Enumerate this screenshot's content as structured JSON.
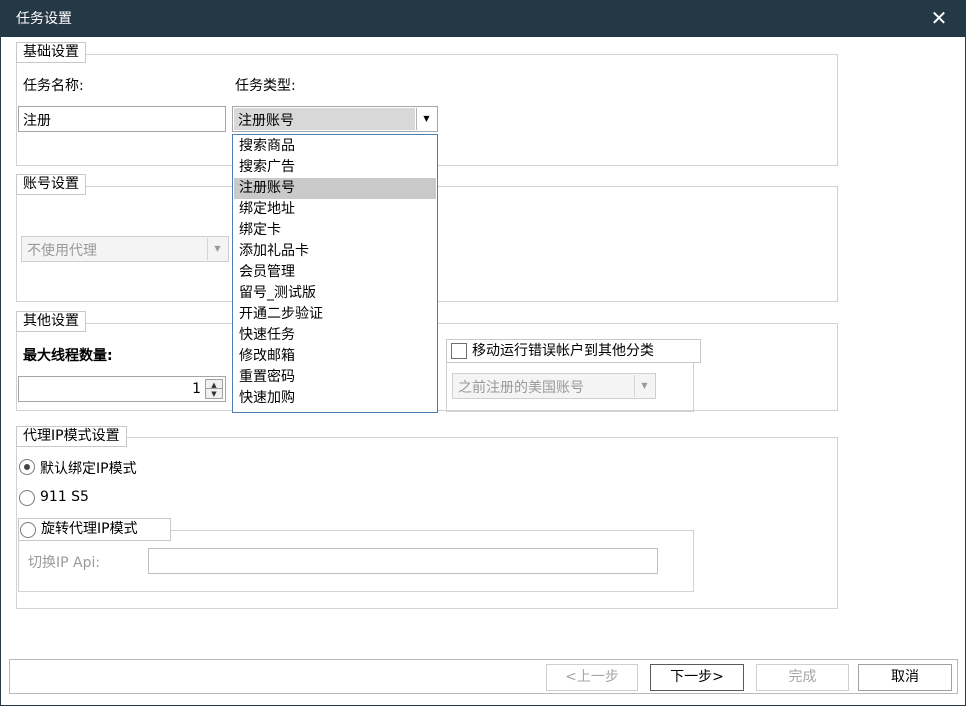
{
  "window": {
    "title": "任务设置",
    "close_glyph": "✕"
  },
  "basic": {
    "legend": "基础设置",
    "name_label": "任务名称:",
    "type_label": "任务类型:",
    "name_value": "注册",
    "type_value": "注册账号",
    "type_options": [
      "搜索商品",
      "搜索广告",
      "注册账号",
      "绑定地址",
      "绑定卡",
      "添加礼品卡",
      "会员管理",
      "留号_测试版",
      "开通二步验证",
      "快速任务",
      "修改邮箱",
      "重置密码",
      "快速加购"
    ],
    "selected_option": "注册账号"
  },
  "account": {
    "legend": "账号设置",
    "proxy_value": "不使用代理"
  },
  "other": {
    "legend": "其他设置",
    "threads_label": "最大线程数量:",
    "threads_value": "1",
    "move_checkbox_label": "移动运行错误帐户到其他分类",
    "move_checked": false,
    "category_value": "之前注册的美国账号"
  },
  "proxy_ip": {
    "legend": "代理IP模式设置",
    "radio_default": "默认绑定IP模式",
    "radio_911": "911 S5",
    "radio_rotate": "旋转代理IP模式",
    "selected": "默认绑定IP模式",
    "api_label": "切换IP Api:",
    "api_value": ""
  },
  "footer": {
    "prev": "<上一步",
    "next": "下一步>",
    "finish": "完成",
    "cancel": "取消"
  },
  "colors": {
    "titlebar": "#253846",
    "dropdown_border": "#4b7fb5",
    "selected_bg": "#c9c9c9"
  }
}
